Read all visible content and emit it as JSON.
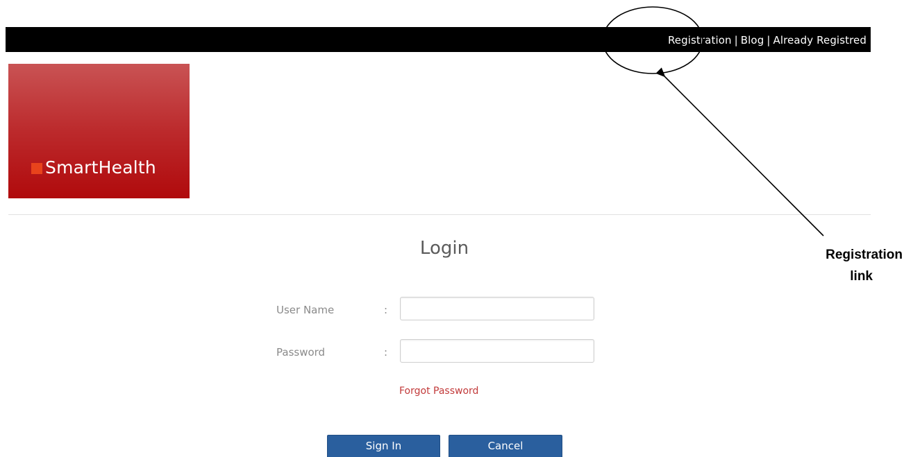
{
  "topnav": {
    "items": [
      "Registration",
      "Blog",
      "Already Registred"
    ],
    "separator": "|"
  },
  "logo": {
    "text": "SmartHealth",
    "mark_color": "#e8431c",
    "gradient_top": "#c95354",
    "gradient_bottom": "#b00a0c"
  },
  "login": {
    "title": "Login",
    "username_label": "User Name",
    "password_label": "Password",
    "colon": ":",
    "username_value": "",
    "password_value": "",
    "forgot_link": "Forgot Password",
    "signin_label": "Sign In",
    "cancel_label": "Cancel"
  },
  "annotation": {
    "line1": "Registration",
    "line2": "link"
  },
  "colors": {
    "topbar": "#000000",
    "button": "#2a5f9e",
    "forgot_link": "#c23a3a"
  }
}
